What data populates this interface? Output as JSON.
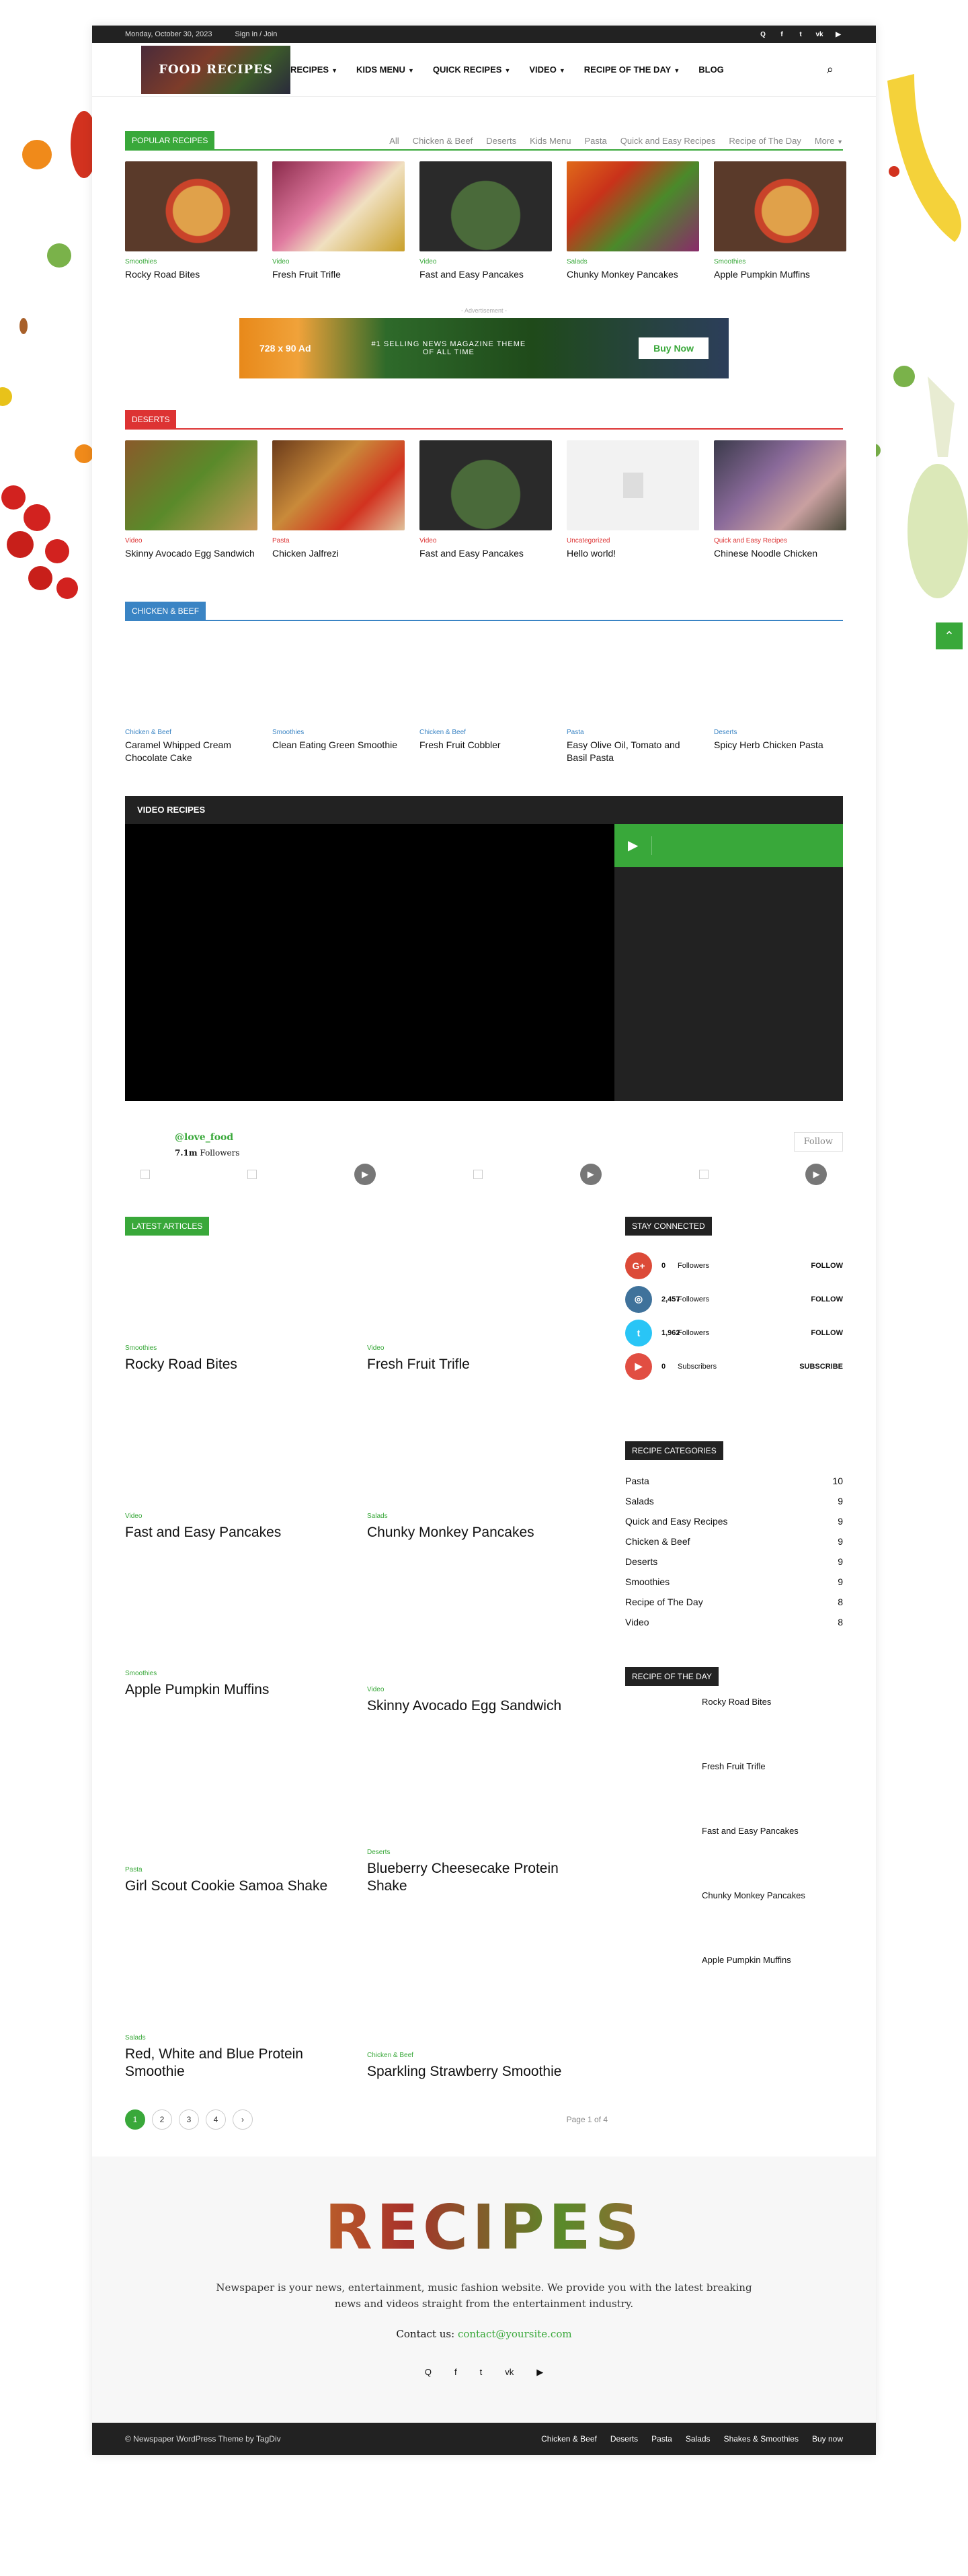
{
  "topbar": {
    "date": "Monday, October 30, 2023",
    "sign_in": "Sign in / Join",
    "socials": [
      "Q",
      "f",
      "t",
      "vk",
      "▶"
    ]
  },
  "header": {
    "logo_text": "FOOD RECIPES",
    "menu": [
      {
        "label": "RECIPES",
        "chevron": true
      },
      {
        "label": "KIDS MENU",
        "chevron": true
      },
      {
        "label": "QUICK RECIPES",
        "chevron": true
      },
      {
        "label": "VIDEO",
        "chevron": true
      },
      {
        "label": "RECIPE OF THE DAY",
        "chevron": true
      },
      {
        "label": "BLOG",
        "chevron": false
      }
    ]
  },
  "popular": {
    "title": "POPULAR RECIPES",
    "filters": [
      "All",
      "Chicken & Beef",
      "Deserts",
      "Kids Menu",
      "Pasta",
      "Quick and Easy Recipes",
      "Recipe of The Day",
      "More"
    ],
    "items": [
      {
        "cat": "Smoothies",
        "title": "Rocky Road Bites"
      },
      {
        "cat": "Video",
        "title": "Fresh Fruit Trifle"
      },
      {
        "cat": "Video",
        "title": "Fast and Easy Pancakes"
      },
      {
        "cat": "Salads",
        "title": "Chunky Monkey Pancakes"
      },
      {
        "cat": "Smoothies",
        "title": "Apple Pumpkin Muffins"
      }
    ]
  },
  "ad": {
    "label": "- Advertisement -",
    "size": "728 x 90 Ad",
    "line1": "#1 SELLING NEWS MAGAZINE THEME",
    "line2": "OF ALL TIME",
    "button": "Buy Now"
  },
  "deserts": {
    "title": "DESERTS",
    "items": [
      {
        "cat": "Video",
        "title": "Skinny Avocado Egg Sandwich"
      },
      {
        "cat": "Pasta",
        "title": "Chicken Jalfrezi"
      },
      {
        "cat": "Video",
        "title": "Fast and Easy Pancakes"
      },
      {
        "cat": "Uncategorized",
        "title": "Hello world!"
      },
      {
        "cat": "Quick and Easy Recipes",
        "title": "Chinese Noodle Chicken"
      }
    ]
  },
  "chicken": {
    "title": "CHICKEN & BEEF",
    "items": [
      {
        "cat": "Chicken & Beef",
        "title": "Caramel Whipped Cream Chocolate Cake"
      },
      {
        "cat": "Smoothies",
        "title": "Clean Eating Green Smoothie"
      },
      {
        "cat": "Chicken & Beef",
        "title": "Fresh Fruit Cobbler"
      },
      {
        "cat": "Pasta",
        "title": "Easy Olive Oil, Tomato and Basil Pasta"
      },
      {
        "cat": "Deserts",
        "title": "Spicy Herb Chicken Pasta"
      }
    ]
  },
  "video": {
    "title": "VIDEO RECIPES"
  },
  "instagram": {
    "handle": "@love_food",
    "followers_num": "7.1m",
    "followers_label": "Followers",
    "follow_button": "Follow"
  },
  "latest": {
    "title": "LATEST ARTICLES",
    "items": [
      {
        "cat": "Smoothies",
        "title": "Rocky Road Bites"
      },
      {
        "cat": "Video",
        "title": "Fresh Fruit Trifle"
      },
      {
        "cat": "Video",
        "title": "Fast and Easy Pancakes"
      },
      {
        "cat": "Salads",
        "title": "Chunky Monkey Pancakes"
      },
      {
        "cat": "Smoothies",
        "title": "Apple Pumpkin Muffins"
      },
      {
        "cat": "Video",
        "title": "Skinny Avocado Egg Sandwich"
      },
      {
        "cat": "Pasta",
        "title": "Girl Scout Cookie Samoa Shake"
      },
      {
        "cat": "Deserts",
        "title": "Blueberry Cheesecake Protein Shake"
      },
      {
        "cat": "Salads",
        "title": "Red, White and Blue Protein Smoothie"
      },
      {
        "cat": "Chicken & Beef",
        "title": "Sparkling Strawberry Smoothie"
      }
    ]
  },
  "pagination": {
    "pages": [
      "1",
      "2",
      "3",
      "4",
      "›"
    ],
    "info": "Page 1 of 4"
  },
  "sidebar": {
    "connected_title": "STAY CONNECTED",
    "connected": [
      {
        "icon": "G+",
        "num": "0",
        "label": "Followers",
        "action": "FOLLOW",
        "color": "#dc4a38"
      },
      {
        "icon": "◎",
        "num": "2,457",
        "label": "Followers",
        "action": "FOLLOW",
        "color": "#3f729b"
      },
      {
        "icon": "t",
        "num": "1,962",
        "label": "Followers",
        "action": "FOLLOW",
        "color": "#29c5f6"
      },
      {
        "icon": "▶",
        "num": "0",
        "label": "Subscribers",
        "action": "SUBSCRIBE",
        "color": "#e14e42"
      }
    ],
    "categories_title": "RECIPE CATEGORIES",
    "categories": [
      {
        "name": "Pasta",
        "count": "10"
      },
      {
        "name": "Salads",
        "count": "9"
      },
      {
        "name": "Quick and Easy Recipes",
        "count": "9"
      },
      {
        "name": "Chicken & Beef",
        "count": "9"
      },
      {
        "name": "Deserts",
        "count": "9"
      },
      {
        "name": "Smoothies",
        "count": "9"
      },
      {
        "name": "Recipe of The Day",
        "count": "8"
      },
      {
        "name": "Video",
        "count": "8"
      }
    ],
    "rod_title": "RECIPE OF THE DAY",
    "rod": [
      "Rocky Road Bites",
      "Fresh Fruit Trifle",
      "Fast and Easy Pancakes",
      "Chunky Monkey Pancakes",
      "Apple Pumpkin Muffins"
    ]
  },
  "footer": {
    "logo": "RECIPES",
    "desc": "Newspaper is your news, entertainment, music fashion website. We provide you with the latest breaking news and videos straight from the entertainment industry.",
    "contact_label": "Contact us:",
    "contact_email": "contact@yoursite.com",
    "socials": [
      "Q",
      "f",
      "t",
      "vk",
      "▶"
    ]
  },
  "bottombar": {
    "copyright": "© Newspaper WordPress Theme by TagDiv",
    "links": [
      "Chicken & Beef",
      "Deserts",
      "Pasta",
      "Salads",
      "Shakes & Smoothies",
      "Buy now"
    ]
  },
  "colors": {
    "accent": "#39a83a",
    "deserts": "#dd3333",
    "chicken": "#3a84c4",
    "dark": "#222222"
  }
}
